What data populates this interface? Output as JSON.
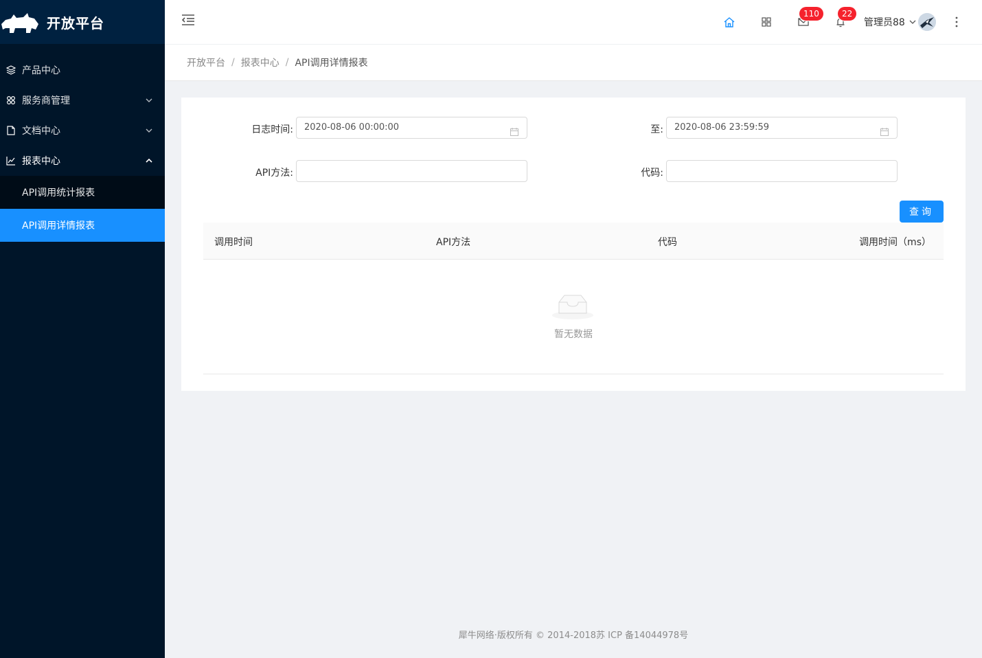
{
  "brand": {
    "name": "开放平台"
  },
  "sidebar": {
    "items": [
      {
        "label": "产品中心",
        "icon": "layers-icon"
      },
      {
        "label": "服务商管理",
        "icon": "group-icon"
      },
      {
        "label": "文档中心",
        "icon": "file-icon"
      },
      {
        "label": "报表中心",
        "icon": "line-chart-icon",
        "open": true
      }
    ],
    "subitems": [
      {
        "label": "API调用统计报表"
      },
      {
        "label": "API调用详情报表",
        "active": true
      }
    ]
  },
  "header": {
    "mail_badge": "110",
    "bell_badge": "22",
    "username": "管理员88"
  },
  "breadcrumb": [
    "开放平台",
    "报表中心",
    "API调用详情报表"
  ],
  "form": {
    "log_time_label": "日志时间:",
    "start_value": "2020-08-06 00:00:00",
    "to_label": "至:",
    "end_value": "2020-08-06 23:59:59",
    "api_method_label": "API方法:",
    "api_method_value": "",
    "code_label": "代码:",
    "code_value": "",
    "query_label": "查询"
  },
  "table": {
    "columns": [
      "调用时间",
      "API方法",
      "代码",
      "调用时间（ms）"
    ],
    "rows": [],
    "empty_text": "暂无数据"
  },
  "footer": {
    "text": "犀牛网络·版权所有 © 2014-2018苏 ICP 备14044978号"
  },
  "colors": {
    "sidebar_bg": "#001529",
    "accent": "#1890ff",
    "badge": "#f5222d"
  }
}
